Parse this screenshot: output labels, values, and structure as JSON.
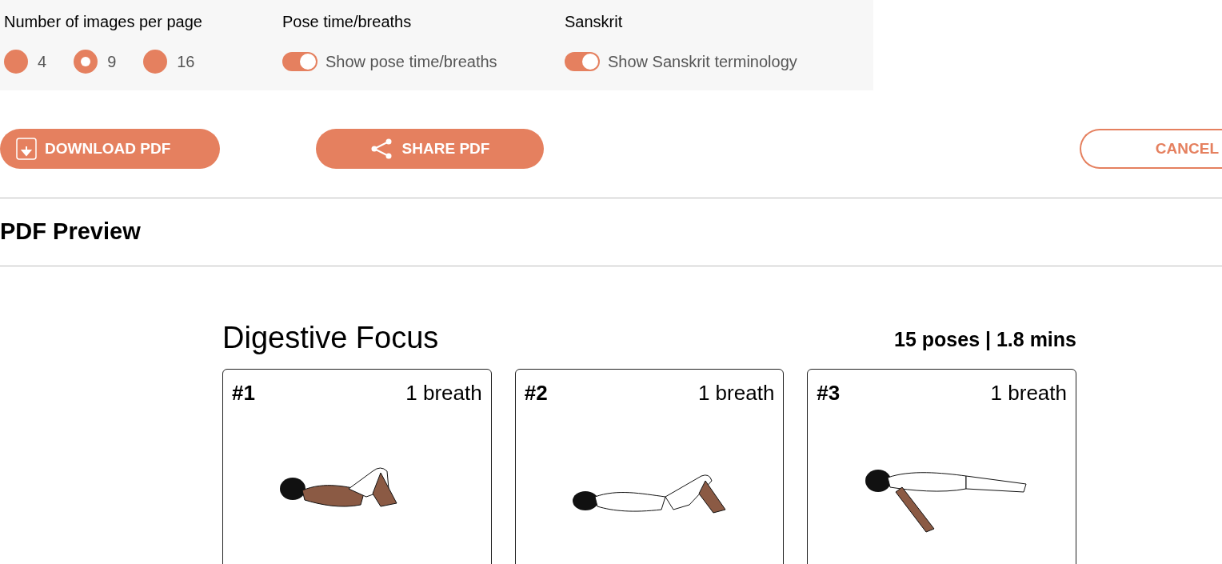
{
  "options": [
    {
      "kind": "radio",
      "heading": "Number of images per page",
      "choices": [
        {
          "label": "4",
          "selected": false
        },
        {
          "label": "9",
          "selected": true
        },
        {
          "label": "16",
          "selected": false
        }
      ]
    },
    {
      "kind": "toggle",
      "heading": "Pose time/breaths",
      "label": "Show pose time/breaths",
      "on": true
    },
    {
      "kind": "toggle",
      "heading": "Sanskrit",
      "label": "Show Sanskrit terminology",
      "on": true
    }
  ],
  "actions": {
    "download": "DOWNLOAD PDF",
    "share": "SHARE PDF",
    "cancel": "CANCEL"
  },
  "section_title": "PDF Preview",
  "preview": {
    "title": "Digestive Focus",
    "summary": "15 poses | 1.8 mins",
    "cards": [
      {
        "number": "#1",
        "duration": "1 breath"
      },
      {
        "number": "#2",
        "duration": "1 breath"
      },
      {
        "number": "#3",
        "duration": "1 breath"
      }
    ]
  }
}
